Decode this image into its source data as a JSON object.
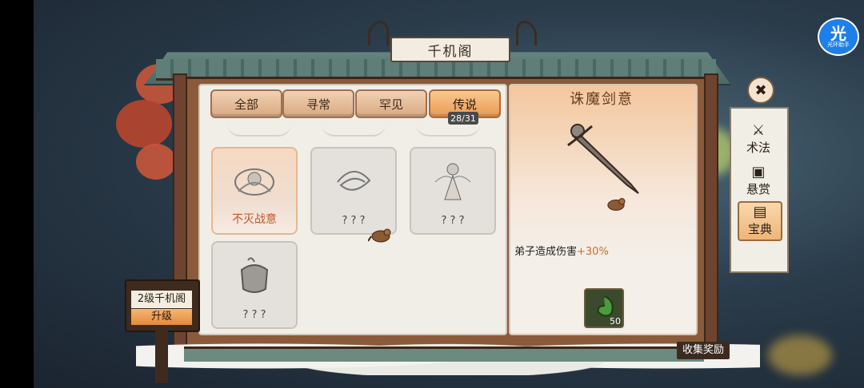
{
  "app": {
    "logo_big": "光",
    "logo_small": "光环助手"
  },
  "window": {
    "title": "千机阁"
  },
  "tabs": [
    {
      "label": "全部",
      "active": false
    },
    {
      "label": "寻常",
      "active": false
    },
    {
      "label": "罕见",
      "active": false
    },
    {
      "label": "传说",
      "active": true
    }
  ],
  "progress": "28/31",
  "cards": [
    {
      "label": "不灭战意",
      "highlight": true
    },
    {
      "label": "? ? ?",
      "highlight": false
    },
    {
      "label": "? ? ?",
      "highlight": false
    },
    {
      "label": "? ? ?",
      "highlight": false
    }
  ],
  "detail": {
    "title": "诛魔剑意",
    "desc_prefix": "弟子造成伤害",
    "desc_value": "+30%",
    "reward_count": "50"
  },
  "nav": [
    {
      "label": "术法",
      "icon": "swords-icon",
      "selected": false
    },
    {
      "label": "悬赏",
      "icon": "chest-icon",
      "selected": false
    },
    {
      "label": "宝典",
      "icon": "book-icon",
      "selected": true
    }
  ],
  "level_sign": {
    "title": "2级千机阁",
    "button": "升级"
  },
  "collect_label": "收集奖励",
  "colors": {
    "accent": "#e89a55",
    "highlight_text": "#c5562c",
    "percent": "#d26a2b"
  }
}
